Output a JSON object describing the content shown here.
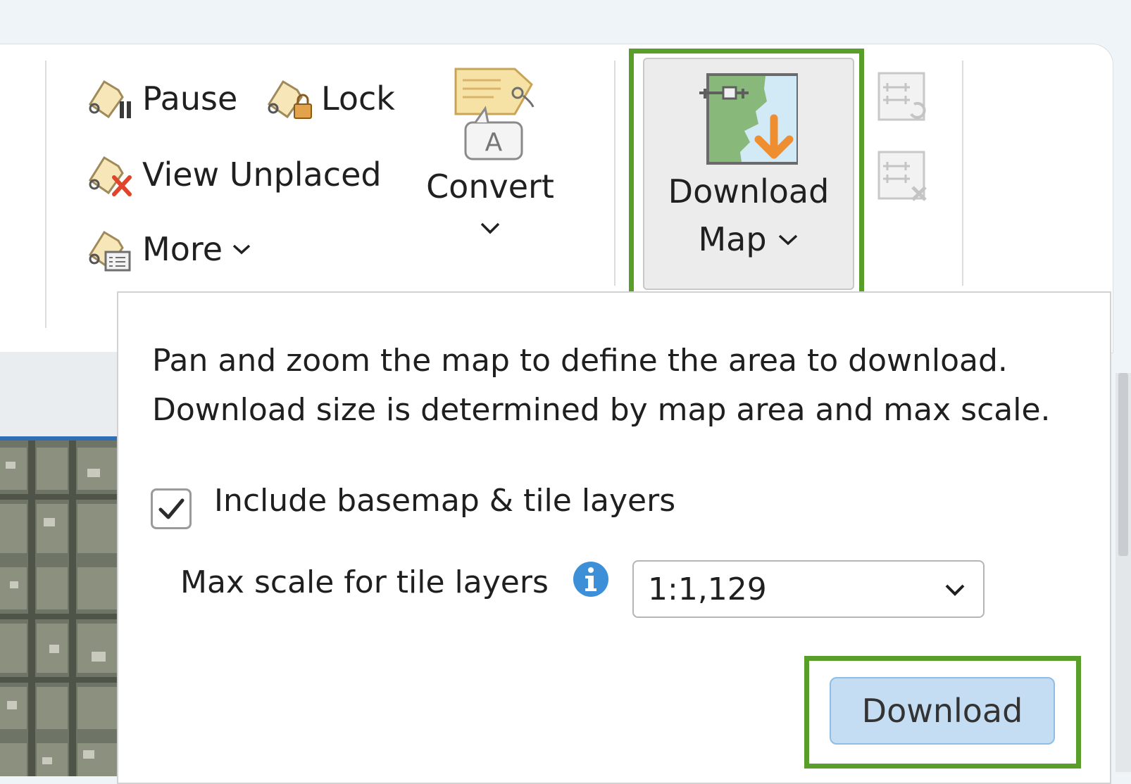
{
  "ribbon": {
    "labeling_group": {
      "pause_label": "Pause",
      "lock_label": "Lock",
      "view_unplaced_label": "View Unplaced",
      "more_label": "More",
      "convert_label": "Convert",
      "convert_chevron": "⌄"
    },
    "offline_group": {
      "download_map_line1": "Download",
      "download_map_line2": "Map"
    }
  },
  "popup": {
    "description_line1": "Pan and zoom the map to define the area to download.",
    "description_line2": "Download size is determined by map area and max scale.",
    "include_basemap_label": "Include basemap & tile layers",
    "include_basemap_checked": true,
    "max_scale_label": "Max scale for tile layers",
    "max_scale_value": "1:1,129",
    "download_button_label": "Download"
  },
  "colors": {
    "highlight": "#5a9e2a",
    "accent_blue": "#2f6db5",
    "download_button_bg": "#c5ddf2",
    "info_icon": "#3d8fd8"
  }
}
